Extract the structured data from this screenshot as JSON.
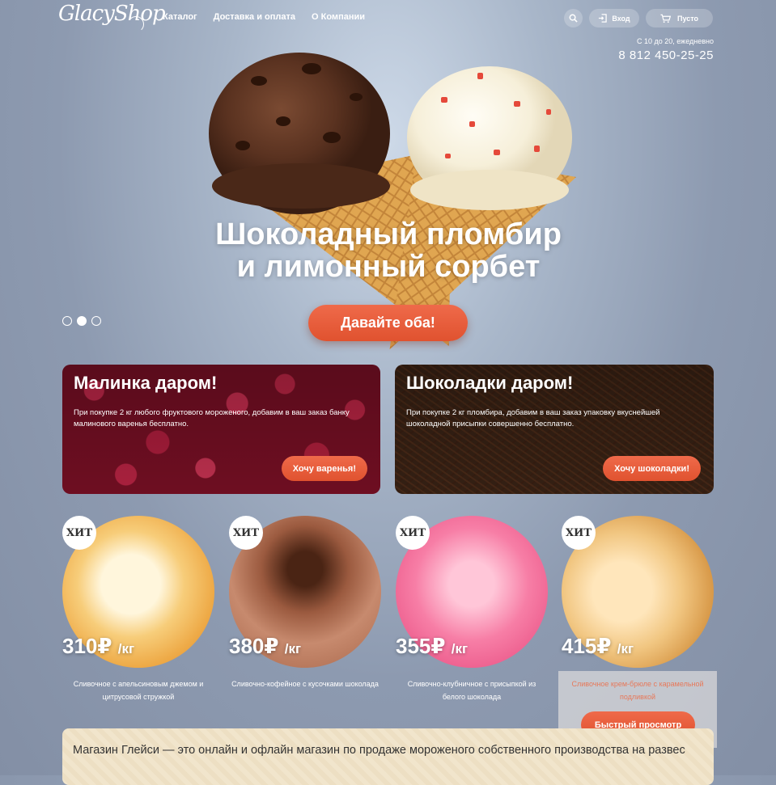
{
  "header": {
    "logo": "GlacyShop",
    "nav": [
      "Каталог",
      "Доставка и оплата",
      "О Компании"
    ],
    "login_label": "Вход",
    "cart_label": "Пусто",
    "hours": "С 10 до 20, ежедневно",
    "phone": "8 812 450-25-25"
  },
  "hero": {
    "title_line1": "Шоколадный пломбир",
    "title_line2": "и лимонный сорбет",
    "cta": "Давайте оба!",
    "slides": 3,
    "active_slide": 2
  },
  "promos": [
    {
      "title": "Малинка даром!",
      "text": "При покупке 2 кг любого фруктового мороженого, добавим в ваш заказ банку малинового варенья бесплатно.",
      "button": "Хочу варенья!"
    },
    {
      "title": "Шоколадки даром!",
      "text": "При покупке 2 кг пломбира, добавим в ваш заказ упаковку вкуснейшей шоколадной присыпки совершенно бесплатно.",
      "button": "Хочу шоколадки!"
    }
  ],
  "products": [
    {
      "badge": "ХИТ",
      "price": "310₽",
      "unit": "/кг",
      "desc": "Сливочное с апельсиновым джемом и цитрусовой стружкой"
    },
    {
      "badge": "ХИТ",
      "price": "380₽",
      "unit": "/кг",
      "desc": "Сливочно-кофейное с кусочками шоколада"
    },
    {
      "badge": "ХИТ",
      "price": "355₽",
      "unit": "/кг",
      "desc": "Сливочно-клубничное с присыпкой из белого шоколада"
    },
    {
      "badge": "ХИТ",
      "price": "415₽",
      "unit": "/кг",
      "desc": "Сливочное крем-брюле с карамельной подливкой"
    }
  ],
  "quick_view": "Быстрый просмотр",
  "about": "Магазин Глейси — это онлайн и офлайн магазин по продаже мороженого собственного производства на развес",
  "colors": {
    "accent": "#e85a38",
    "background": "#8d9ab0"
  }
}
